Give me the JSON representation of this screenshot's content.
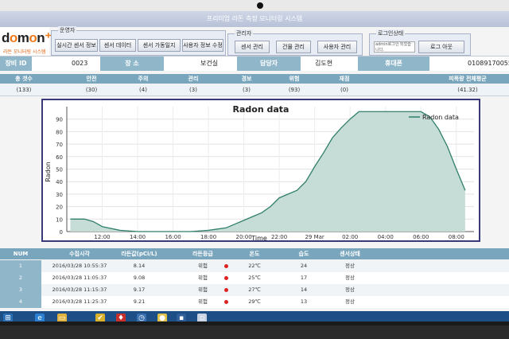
{
  "app": {
    "title": "프리미엄 라돈 측정 모니터링 시스템"
  },
  "logo": {
    "text_main": "domon",
    "text_sub": "라돈 모니터링 시스템"
  },
  "groups": {
    "operator": {
      "label": "운영자",
      "buttons": [
        "실시간 센서 정보",
        "센서 데이터",
        "센서 가동일지",
        "사용자 정보 수정"
      ]
    },
    "admin": {
      "label": "관리자",
      "buttons": [
        "센서 관리",
        "건물 관리",
        "사용자 관리"
      ]
    },
    "login": {
      "label": "로그인상태",
      "status_text": "admin로그인 되었습니다.",
      "logout": "로그 아웃"
    }
  },
  "info": {
    "device_id_label": "장비 ID",
    "device_id": "0023",
    "location_label": "장 소",
    "location": "보건실",
    "manager_label": "담당자",
    "manager": "김도현",
    "phone_label": "휴대폰",
    "phone": "01089170055"
  },
  "stats": {
    "headers": [
      "총 갯수",
      "안전",
      "주의",
      "관리",
      "경보",
      "위험",
      "재점",
      "피폭량 전체평균"
    ],
    "values": [
      "(133)",
      "(30)",
      "(4)",
      "(3)",
      "(3)",
      "(93)",
      "(0)",
      "(41.32)"
    ]
  },
  "chart_data": {
    "type": "area",
    "title": "Radon data",
    "xlabel": "Time",
    "ylabel": "Radon",
    "ylim": [
      0,
      100
    ],
    "yticks": [
      0,
      10,
      20,
      30,
      40,
      50,
      60,
      70,
      80,
      90
    ],
    "xticks": [
      "12:00",
      "14:00",
      "16:00",
      "18:00",
      "20:00",
      "22:00",
      "29 Mar",
      "02:00",
      "04:00",
      "06:00",
      "08:00"
    ],
    "legend": "top-right",
    "series": [
      {
        "name": "Radon data",
        "x_hours": [
          10.2,
          11,
          11.5,
          12,
          13,
          14,
          15,
          16,
          17,
          18,
          19,
          19.5,
          20,
          20.5,
          21,
          21.5,
          22,
          22.5,
          23,
          23.5,
          24,
          24.5,
          25,
          25.5,
          26,
          26.5,
          27,
          28,
          29,
          30,
          30.5,
          31,
          31.5,
          32,
          32.5
        ],
        "values": [
          10,
          10,
          8,
          4,
          1,
          0,
          0,
          0,
          0,
          1,
          3,
          6,
          9,
          12,
          15,
          20,
          27,
          30,
          33,
          40,
          52,
          63,
          75,
          83,
          90,
          96,
          96,
          96,
          96,
          96,
          92,
          82,
          68,
          50,
          33
        ]
      }
    ],
    "colors": {
      "fill": "#c6dcd6",
      "line": "#2f7f6a"
    }
  },
  "table": {
    "headers": [
      "NUM",
      "수집시각",
      "라돈값(pCi/L)",
      "라돈등급",
      "온도",
      "습도",
      "센서상태"
    ],
    "rows": [
      [
        "1",
        "2016/03/28 10:55:37",
        "8.14",
        "위험",
        "22℃",
        "24",
        "정상"
      ],
      [
        "2",
        "2016/03/28 11:05:37",
        "9.08",
        "위험",
        "25℃",
        "17",
        "정상"
      ],
      [
        "3",
        "2016/03/28 11:15:37",
        "9.17",
        "위험",
        "27℃",
        "14",
        "정상"
      ],
      [
        "4",
        "2016/03/28 11:25:37",
        "9.21",
        "위험",
        "29℃",
        "13",
        "정상"
      ]
    ]
  },
  "taskbar": {
    "icons": [
      "windows-icon",
      "ie-icon",
      "folder-icon",
      "check-icon",
      "antivirus-icon",
      "clock-icon",
      "app-icon",
      "app2-icon",
      "window-icon"
    ]
  }
}
